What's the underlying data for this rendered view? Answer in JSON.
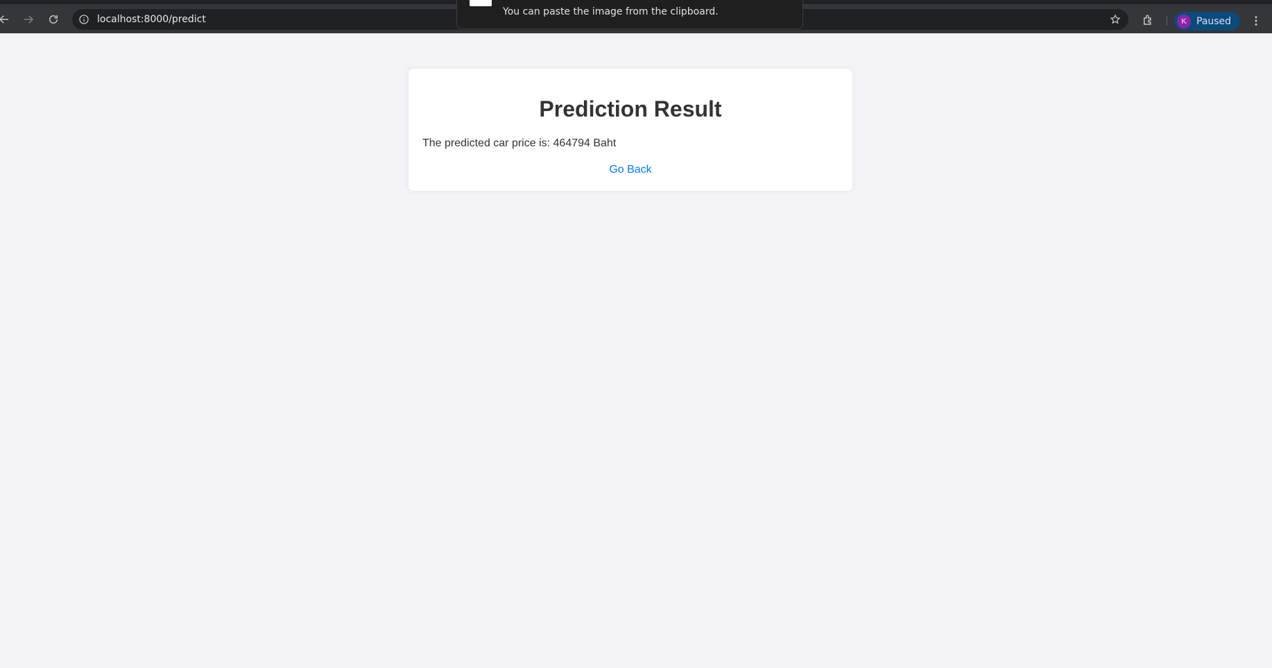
{
  "browser": {
    "url": "localhost:8000/predict",
    "profile": {
      "initial": "K",
      "status": "Paused",
      "avatar_color": "#8e24aa"
    },
    "icons": [
      "back-icon",
      "forward-icon",
      "reload-icon",
      "site-info-icon",
      "star-icon",
      "extensions-icon",
      "more-menu-icon"
    ]
  },
  "toast": {
    "message": "You can paste the image from the clipboard."
  },
  "result": {
    "title": "Prediction Result",
    "prediction_text": "The predicted car price is: 464794 Baht",
    "back_link": "Go Back"
  },
  "colors": {
    "page_bg": "#f4f4f8",
    "link": "#007bff",
    "text": "#333333"
  }
}
